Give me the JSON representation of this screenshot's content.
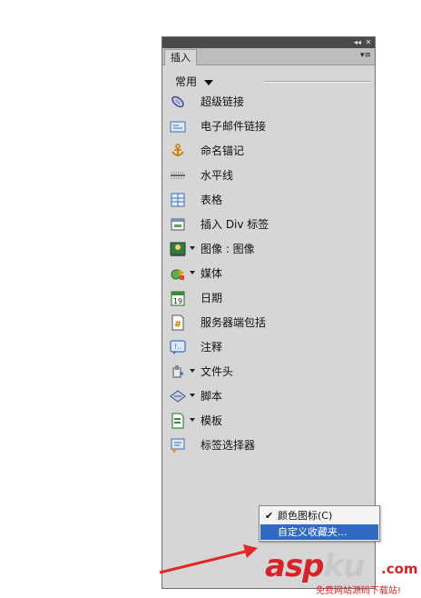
{
  "panel": {
    "tab_label": "插入",
    "title_buttons": [
      "◂◂",
      "✕"
    ],
    "menu_glyph": "▾≡",
    "category": "常用"
  },
  "items": [
    {
      "label": "超级链接",
      "icon": "hyperlink-icon",
      "dropdown": false
    },
    {
      "label": "电子邮件链接",
      "icon": "email-link-icon",
      "dropdown": false
    },
    {
      "label": "命名锚记",
      "icon": "anchor-icon",
      "dropdown": false
    },
    {
      "label": "水平线",
      "icon": "horizontal-rule-icon",
      "dropdown": false
    },
    {
      "label": "表格",
      "icon": "table-icon",
      "dropdown": false
    },
    {
      "label": "插入 Div 标签",
      "icon": "div-tag-icon",
      "dropdown": false
    },
    {
      "label": "图像 : 图像",
      "icon": "image-icon",
      "dropdown": true
    },
    {
      "label": "媒体",
      "icon": "media-icon",
      "dropdown": true
    },
    {
      "label": "日期",
      "icon": "date-icon",
      "dropdown": false
    },
    {
      "label": "服务器端包括",
      "icon": "server-include-icon",
      "dropdown": false
    },
    {
      "label": "注释",
      "icon": "comment-icon",
      "dropdown": false
    },
    {
      "label": "文件头",
      "icon": "head-icon",
      "dropdown": true
    },
    {
      "label": "脚本",
      "icon": "script-icon",
      "dropdown": true
    },
    {
      "label": "模板",
      "icon": "template-icon",
      "dropdown": true
    },
    {
      "label": "标签选择器",
      "icon": "tag-chooser-icon",
      "dropdown": false
    }
  ],
  "context_menu": {
    "items": [
      {
        "label": "颜色图标(C)",
        "checked": true,
        "highlighted": false
      },
      {
        "label": "自定义收藏夹...",
        "checked": false,
        "highlighted": true
      }
    ]
  },
  "watermark": {
    "brand_main": "asp",
    "brand_ku": "ku",
    "brand_tld": ".com",
    "tagline": "免费网站源码下载站!"
  },
  "colors": {
    "panel_bg": "#d6d6d6",
    "titlebar": "#4a4a4a",
    "highlight": "#316ac5",
    "annotation_red": "#e02828"
  }
}
